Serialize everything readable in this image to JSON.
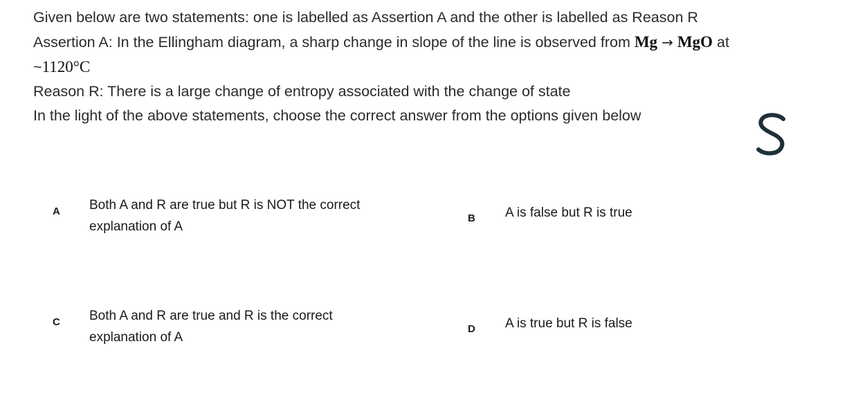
{
  "question": {
    "line1": "Given below are two statements: one is labelled as Assertion A and the other is labelled as Reason R",
    "assertion_prefix": "Assertion A: In the Ellingham diagram, a sharp change in slope of the line is observed from ",
    "math_from": "Mg",
    "arrow": "→",
    "math_to": "MgO",
    "assertion_at": " at",
    "temperature_prefix": "~",
    "temperature": "1120°C",
    "reason": "Reason R: There is a large change of entropy associated with the change of state",
    "instruction": "In the light of the above statements, choose the correct answer from the options given below"
  },
  "scribble_icon": "handwritten-s-mark",
  "scribble_color": "#1f2f38",
  "options": [
    {
      "letter": "A",
      "line1": "Both A and R are true but R is NOT the correct",
      "line2": "explanation of A"
    },
    {
      "letter": "B",
      "line1": "A is false but R is true"
    },
    {
      "letter": "C",
      "line1": "Both A and R are true and R is the correct",
      "line2": "explanation of A"
    },
    {
      "letter": "D",
      "line1": "A is true but R is false"
    }
  ]
}
